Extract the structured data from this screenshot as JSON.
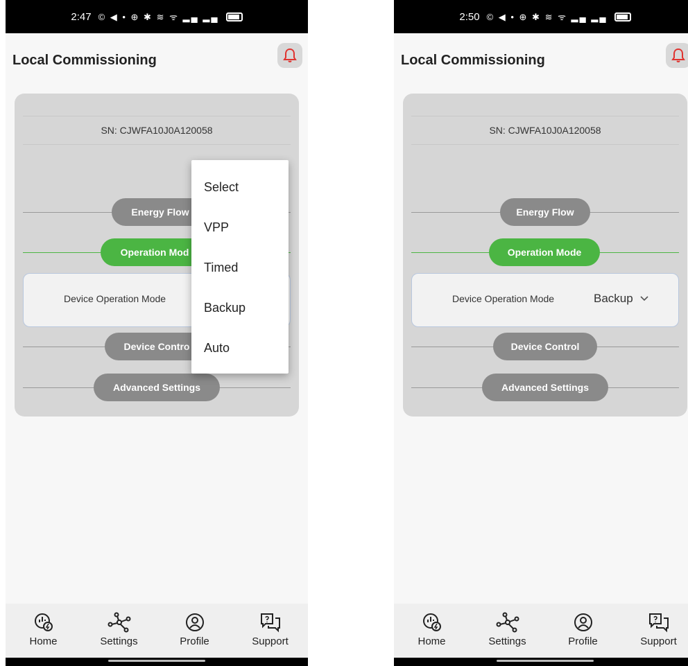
{
  "left": {
    "status_time": "2:47",
    "status_icons": "© ◀ • ⊕ ✱ ≋ ᯤ ▂▄ ▂▄",
    "title": "Local Commissioning",
    "sn": "SN: CJWFA10J0A120058",
    "energy_flow": "Energy Flow",
    "operation_mode": "Operation Mod",
    "device_operation_mode": "Device Operation Mode",
    "device_control": "Device Contro",
    "advanced_settings": "Advanced Settings",
    "dropdown_options": [
      "Select",
      "VPP",
      "Timed",
      "Backup",
      "Auto"
    ]
  },
  "right": {
    "status_time": "2:50",
    "status_icons": "© ◀ • ⊕ ✱ ≋ ᯤ ▂▄ ▂▄",
    "title": "Local Commissioning",
    "sn": "SN: CJWFA10J0A120058",
    "energy_flow": "Energy Flow",
    "operation_mode": "Operation Mode",
    "device_operation_mode": "Device Operation Mode",
    "selected_mode": "Backup",
    "device_control": "Device Control",
    "advanced_settings": "Advanced Settings"
  },
  "nav": [
    "Home",
    "Settings",
    "Profile",
    "Support"
  ],
  "colors": {
    "accent_green": "#4bb543",
    "bell_red": "#e0332f",
    "pill_gray": "#8a8a8a"
  }
}
